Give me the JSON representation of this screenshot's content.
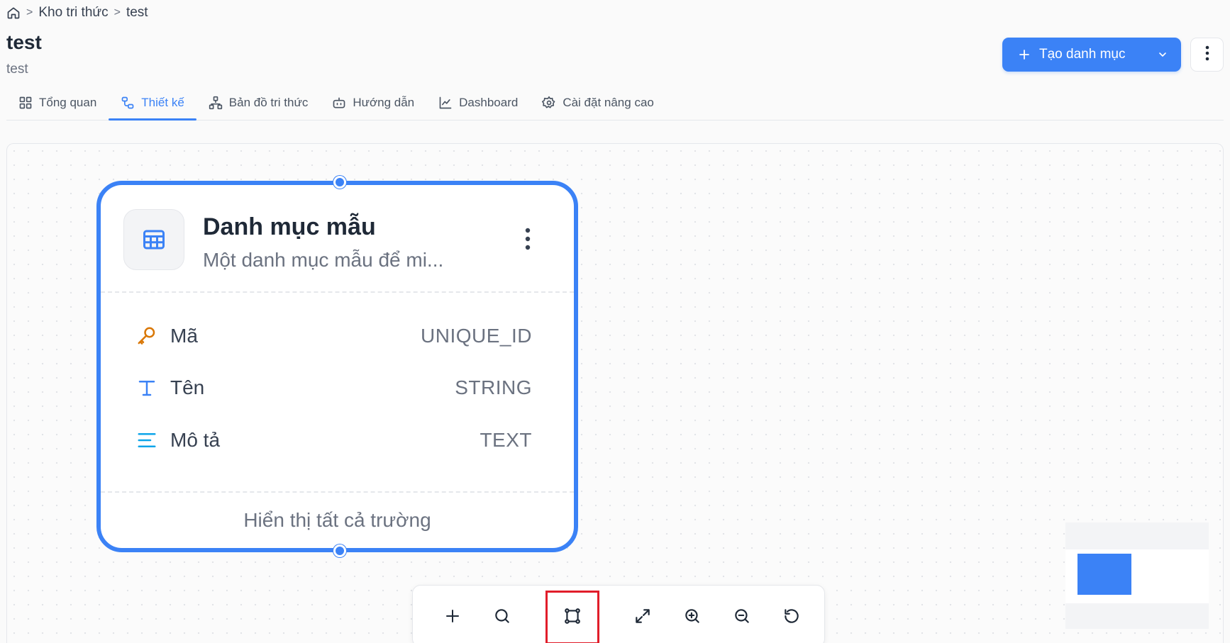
{
  "breadcrumb": {
    "home_icon": "home-icon",
    "items": [
      "Kho tri thức",
      "test"
    ],
    "separator": ">"
  },
  "header": {
    "title": "test",
    "subtitle": "test",
    "create_button_label": "Tạo danh mục",
    "more_icon": "vertical-dots-icon"
  },
  "tabs": [
    {
      "label": "Tổng quan",
      "icon": "grid-icon",
      "active": false
    },
    {
      "label": "Thiết kế",
      "icon": "design-icon",
      "active": true
    },
    {
      "label": "Bản đồ tri thức",
      "icon": "sitemap-icon",
      "active": false
    },
    {
      "label": "Hướng dẫn",
      "icon": "robot-icon",
      "active": false
    },
    {
      "label": "Dashboard",
      "icon": "chart-line-icon",
      "active": false
    },
    {
      "label": "Cài đặt nâng cao",
      "icon": "gear-icon",
      "active": false
    }
  ],
  "node": {
    "title": "Danh mục mẫu",
    "description": "Một danh mục mẫu để mi...",
    "fields": [
      {
        "name": "Mã",
        "type": "UNIQUE_ID",
        "icon": "key-icon"
      },
      {
        "name": "Tên",
        "type": "STRING",
        "icon": "text-t-icon"
      },
      {
        "name": "Mô tả",
        "type": "TEXT",
        "icon": "lines-icon"
      }
    ],
    "footer_label": "Hiển thị tất cả trường"
  },
  "toolbar": {
    "buttons": [
      {
        "name": "add",
        "icon": "plus-icon"
      },
      {
        "name": "search",
        "icon": "search-icon"
      },
      {
        "name": "fit-view",
        "icon": "fit-frame-icon",
        "highlighted": true
      },
      {
        "name": "fullscreen",
        "icon": "expand-icon"
      },
      {
        "name": "zoom-in",
        "icon": "zoom-in-icon"
      },
      {
        "name": "zoom-out",
        "icon": "zoom-out-icon"
      },
      {
        "name": "reset",
        "icon": "rotate-icon"
      }
    ]
  },
  "colors": {
    "accent": "#3b82f6",
    "highlight": "#e11d2a",
    "key_icon": "#d97706"
  }
}
